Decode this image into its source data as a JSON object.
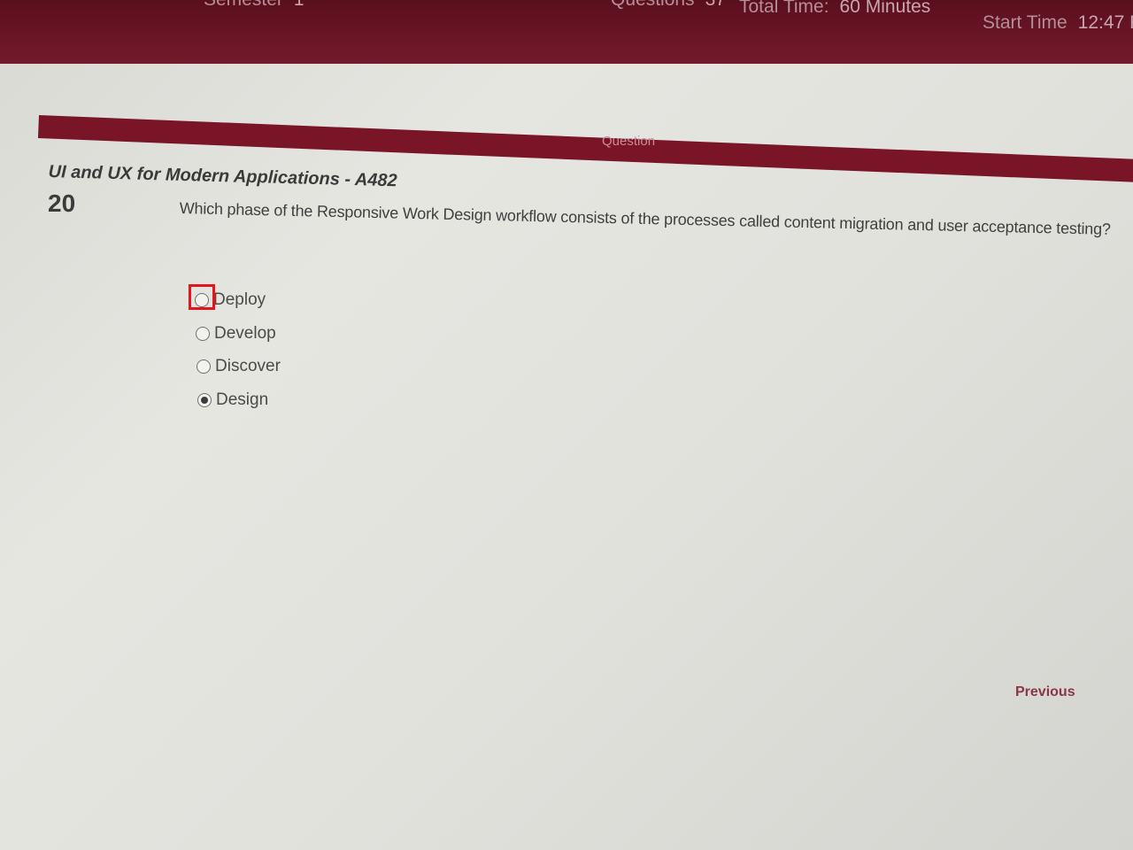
{
  "header": {
    "stats": [
      {
        "label": "Semester",
        "value": "1"
      },
      {
        "label": "Questions",
        "value": "37"
      },
      {
        "label": "Total Time:",
        "value": "60 Minutes"
      },
      {
        "label": "Start Time",
        "value": "12:47 P"
      }
    ],
    "colors": {
      "header_bg": "#6a1424",
      "question_bar": "#7a1528"
    }
  },
  "question_bar": {
    "label": "Question"
  },
  "question": {
    "subject": "UI and UX for Modern Applications - A482",
    "number": "20",
    "text": "Which phase of the Responsive Work Design workflow consists of the processes called content migration and user acceptance testing?"
  },
  "options": [
    {
      "label": "Deploy",
      "selected": false,
      "highlighted": true
    },
    {
      "label": "Develop",
      "selected": false
    },
    {
      "label": "Discover",
      "selected": false
    },
    {
      "label": "Design",
      "selected": true
    }
  ],
  "nav": {
    "previous_label": "Previous"
  },
  "highlight_color": "#e8141d"
}
